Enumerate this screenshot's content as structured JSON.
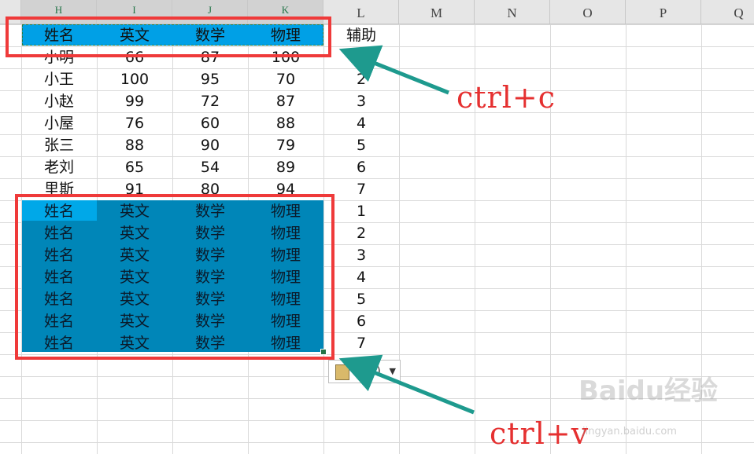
{
  "columns": [
    "H",
    "I",
    "J",
    "K",
    "L",
    "M",
    "N",
    "O",
    "P",
    "Q"
  ],
  "header_row": [
    "姓名",
    "英文",
    "数学",
    "物理"
  ],
  "helper_header": "辅助",
  "source_rows": [
    [
      "小明",
      "66",
      "87",
      "100"
    ],
    [
      "小王",
      "100",
      "95",
      "70"
    ],
    [
      "小赵",
      "99",
      "72",
      "87"
    ],
    [
      "小屋",
      "76",
      "60",
      "88"
    ],
    [
      "张三",
      "88",
      "90",
      "79"
    ],
    [
      "老刘",
      "65",
      "54",
      "89"
    ],
    [
      "里斯",
      "91",
      "80",
      "94"
    ]
  ],
  "helper_values": [
    "1",
    "2",
    "3",
    "4",
    "5",
    "6",
    "7",
    "1",
    "2",
    "3",
    "4",
    "5",
    "6",
    "7"
  ],
  "pasted_rows": [
    [
      "姓名",
      "英文",
      "数学",
      "物理"
    ],
    [
      "姓名",
      "英文",
      "数学",
      "物理"
    ],
    [
      "姓名",
      "英文",
      "数学",
      "物理"
    ],
    [
      "姓名",
      "英文",
      "数学",
      "物理"
    ],
    [
      "姓名",
      "英文",
      "数学",
      "物理"
    ],
    [
      "姓名",
      "英文",
      "数学",
      "物理"
    ],
    [
      "姓名",
      "英文",
      "数学",
      "物理"
    ]
  ],
  "annotations": {
    "copy": "ctrl+c",
    "paste": "ctrl+v"
  },
  "paste_options": {
    "label": "(Ctrl)",
    "icon": "clipboard-icon"
  },
  "watermark": {
    "brand": "Baidu经验",
    "url": "jingyan.baidu.com"
  },
  "colors": {
    "header_fill": "#00a0e6",
    "paste_fill": "#0086b8",
    "annotation_red": "#ef3a3a",
    "arrow_teal": "#1e9a8e"
  }
}
